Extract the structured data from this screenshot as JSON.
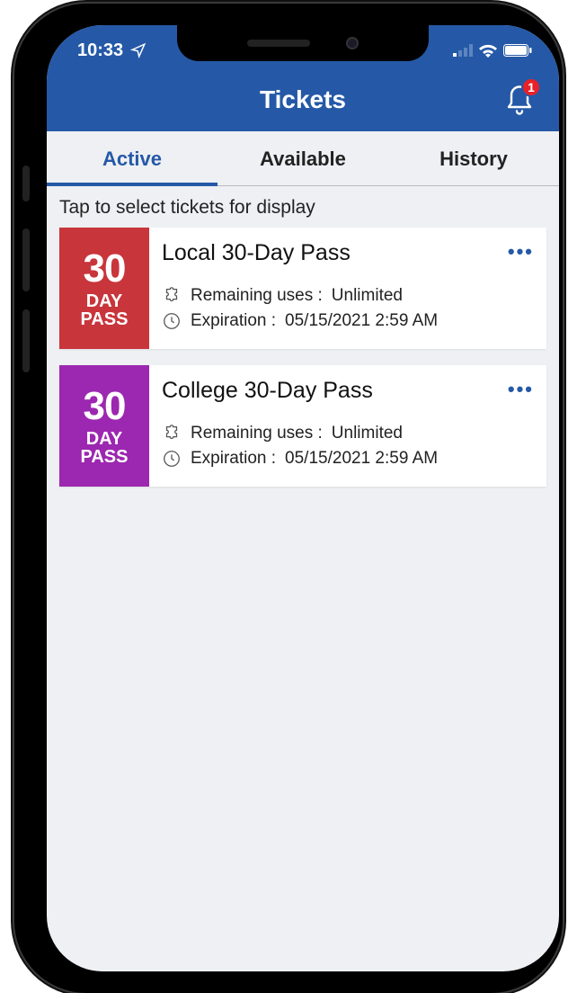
{
  "statusbar": {
    "time": "10:33"
  },
  "appbar": {
    "title": "Tickets",
    "notification_count": "1"
  },
  "tabs": {
    "active": "Active",
    "available": "Available",
    "history": "History"
  },
  "instruction": "Tap to select tickets for display",
  "passes": [
    {
      "chip_big": "30",
      "chip_line2": "DAY",
      "chip_line3": "PASS",
      "chip_color": "#c8353b",
      "title": "Local 30-Day Pass",
      "remaining_label": "Remaining uses :",
      "remaining_value": "Unlimited",
      "expiration_label": "Expiration :",
      "expiration_value": "05/15/2021 2:59 AM"
    },
    {
      "chip_big": "30",
      "chip_line2": "DAY",
      "chip_line3": "PASS",
      "chip_color": "#9c27b0",
      "title": "College 30-Day Pass",
      "remaining_label": "Remaining uses :",
      "remaining_value": "Unlimited",
      "expiration_label": "Expiration :",
      "expiration_value": "05/15/2021 2:59 AM"
    }
  ]
}
